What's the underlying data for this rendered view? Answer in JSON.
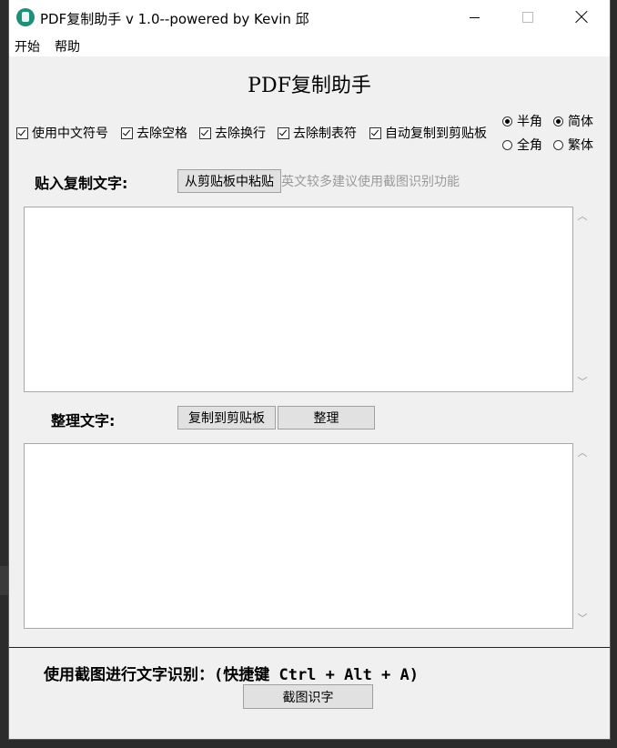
{
  "window": {
    "title": "PDF复制助手 v 1.0--powered by Kevin 邱"
  },
  "menu": {
    "items": [
      "开始",
      "帮助"
    ]
  },
  "app": {
    "heading": "PDF复制助手"
  },
  "options": {
    "checkboxes": [
      {
        "label": "使用中文符号",
        "checked": true
      },
      {
        "label": "去除空格",
        "checked": true
      },
      {
        "label": "去除换行",
        "checked": true
      },
      {
        "label": "去除制表符",
        "checked": true
      },
      {
        "label": "自动复制到剪贴板",
        "checked": true
      }
    ],
    "width_radio": [
      {
        "label": "半角",
        "selected": true
      },
      {
        "label": "全角",
        "selected": false
      }
    ],
    "script_radio": [
      {
        "label": "简体",
        "selected": true
      },
      {
        "label": "繁体",
        "selected": false
      }
    ]
  },
  "paste_section": {
    "label": "贴入复制文字:",
    "paste_button": "从剪贴板中粘贴",
    "hint": "英文较多建议使用截图识别功能",
    "text": ""
  },
  "result_section": {
    "label": "整理文字:",
    "copy_button": "复制到剪贴板",
    "format_button": "整理",
    "text": ""
  },
  "ocr_section": {
    "label": "使用截图进行文字识别：",
    "hotkey": "(快捷键 Ctrl + Alt + A)",
    "button": "截图识字"
  },
  "icons": {
    "app": "pdf-app-icon",
    "minimize": "minimize-icon",
    "maximize": "maximize-icon",
    "close": "close-icon",
    "scroll_up": "chevron-up-icon",
    "scroll_down": "chevron-down-icon"
  }
}
